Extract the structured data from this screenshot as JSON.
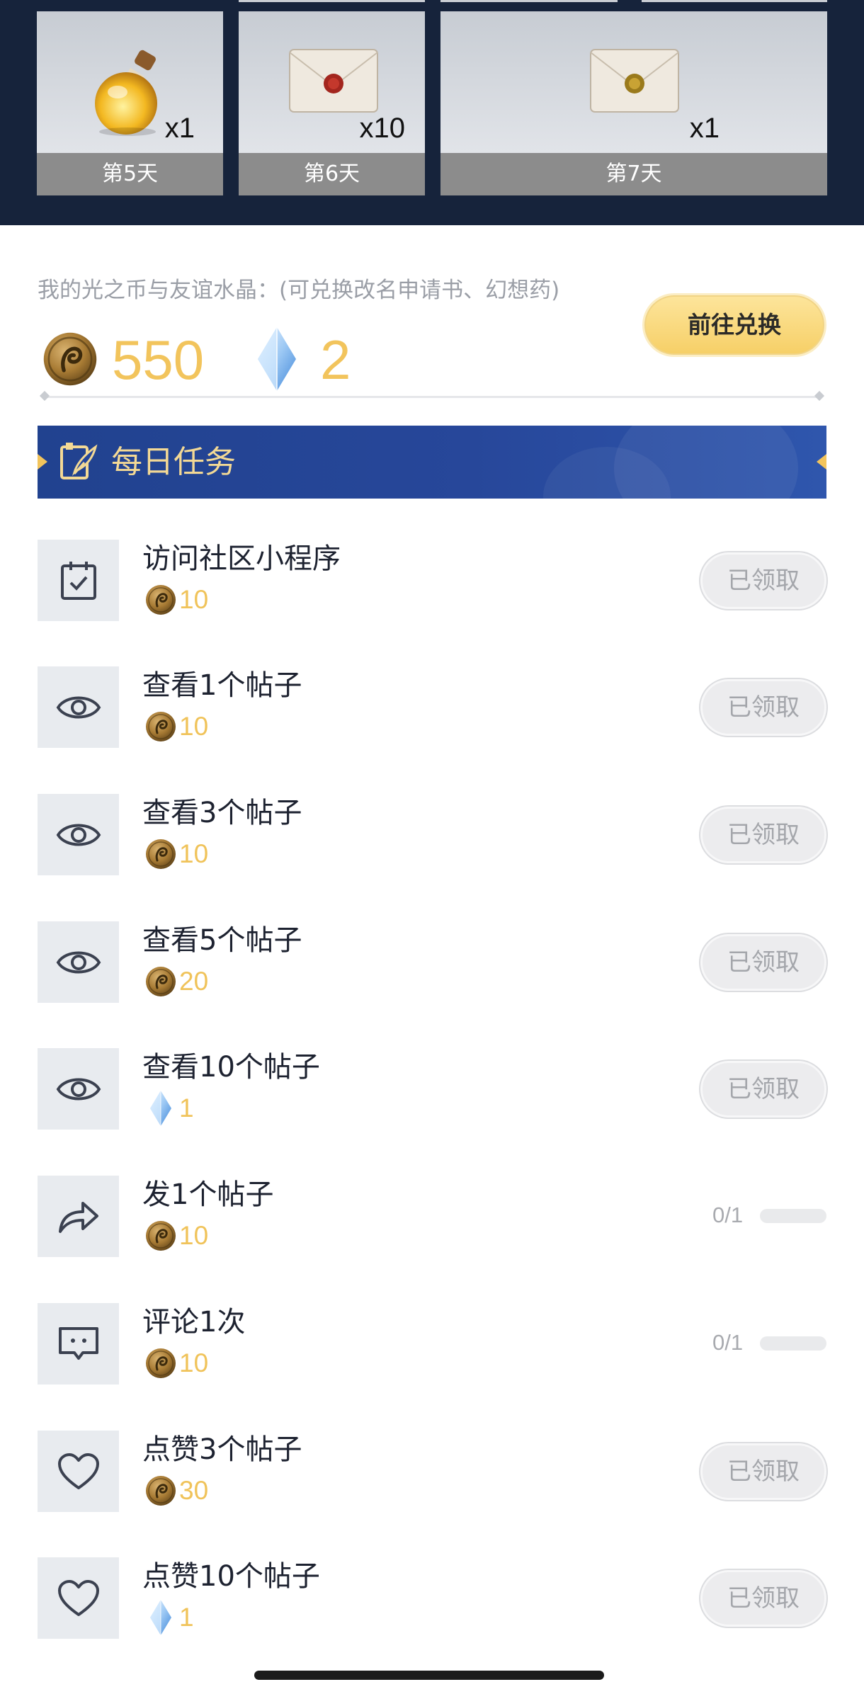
{
  "login_rewards": {
    "days": [
      {
        "label": "第5天",
        "qty": "x1",
        "icon": "potion-bottle-icon"
      },
      {
        "label": "第6天",
        "qty": "x10",
        "icon": "red-seal-envelope-icon"
      },
      {
        "label": "第7天",
        "qty": "x1",
        "icon": "gold-seal-envelope-icon"
      }
    ]
  },
  "currency": {
    "caption": "我的光之币与友谊水晶：(可兑换改名申请书、幻想药)",
    "coins": "550",
    "crystals": "2",
    "exchange_button": "前往兑换"
  },
  "daily_tasks": {
    "title": "每日任务",
    "items": [
      {
        "name": "访问社区小程序",
        "icon": "calendar-check-icon",
        "reward_type": "coin",
        "reward": "10",
        "status": "已领取"
      },
      {
        "name": "查看1个帖子",
        "icon": "eye-icon",
        "reward_type": "coin",
        "reward": "10",
        "status": "已领取"
      },
      {
        "name": "查看3个帖子",
        "icon": "eye-icon",
        "reward_type": "coin",
        "reward": "10",
        "status": "已领取"
      },
      {
        "name": "查看5个帖子",
        "icon": "eye-icon",
        "reward_type": "coin",
        "reward": "20",
        "status": "已领取"
      },
      {
        "name": "查看10个帖子",
        "icon": "eye-icon",
        "reward_type": "crystal",
        "reward": "1",
        "status": "已领取"
      },
      {
        "name": "发1个帖子",
        "icon": "share-arrow-icon",
        "reward_type": "coin",
        "reward": "10",
        "progress": "0/1",
        "progress_fraction": 0
      },
      {
        "name": "评论1次",
        "icon": "comment-icon",
        "reward_type": "coin",
        "reward": "10",
        "progress": "0/1",
        "progress_fraction": 0
      },
      {
        "name": "点赞3个帖子",
        "icon": "heart-icon",
        "reward_type": "coin",
        "reward": "30",
        "status": "已领取"
      },
      {
        "name": "点赞10个帖子",
        "icon": "heart-icon",
        "reward_type": "crystal",
        "reward": "1",
        "status": "已领取"
      }
    ]
  },
  "colors": {
    "header_bg": "#16233b",
    "banner_bg": "#24469a",
    "accent_gold": "#f2c45c"
  }
}
